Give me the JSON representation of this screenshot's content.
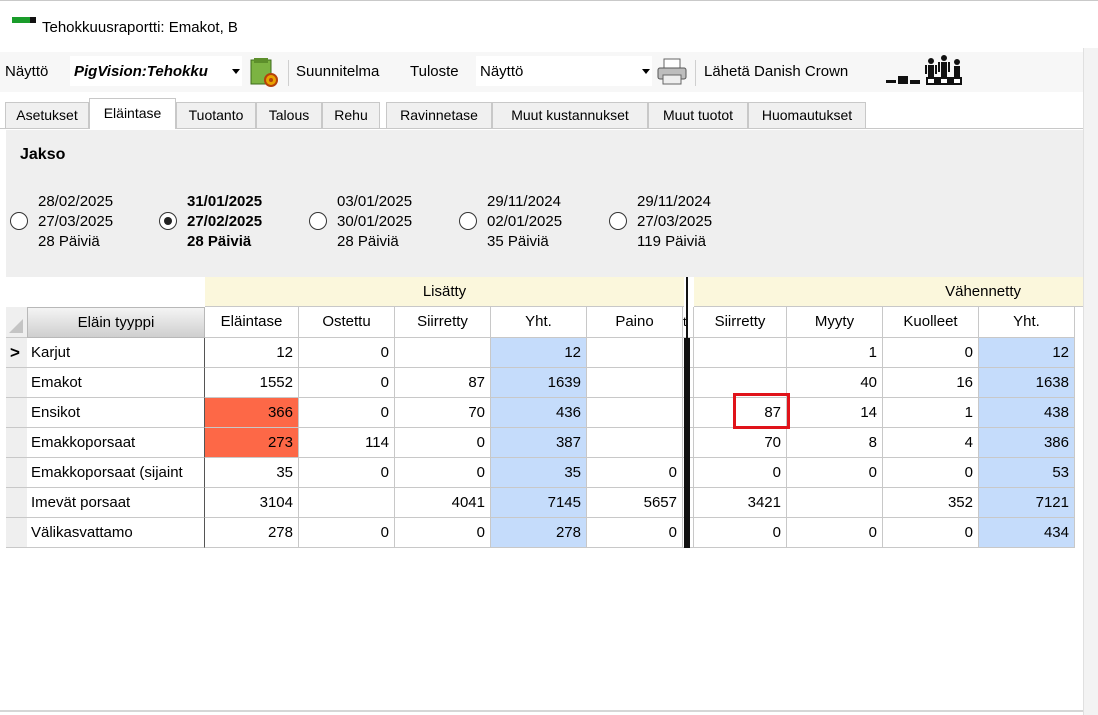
{
  "window": {
    "title": "Tehokkuusraportti: Emakot, B"
  },
  "toolbar": {
    "view_label": "Näyttö",
    "report_value": "PigVision:Tehokku",
    "plan_label": "Suunnitelma",
    "print_label": "Tuloste",
    "print_value": "Näyttö",
    "send_label": "Lähetä Danish Crown"
  },
  "tabs": [
    {
      "label": "Asetukset"
    },
    {
      "label": "Eläintase"
    },
    {
      "label": "Tuotanto"
    },
    {
      "label": "Talous"
    },
    {
      "label": "Rehu"
    },
    {
      "label": "Ravinnetase"
    },
    {
      "label": "Muut kustannukset"
    },
    {
      "label": "Muut tuotot"
    },
    {
      "label": "Huomautukset"
    }
  ],
  "period": {
    "heading": "Jakso",
    "options": [
      {
        "line1": "28/02/2025",
        "line2": "27/03/2025",
        "line3": "28 Päiviä",
        "selected": false
      },
      {
        "line1": "31/01/2025",
        "line2": "27/02/2025",
        "line3": "28 Päiviä",
        "selected": true
      },
      {
        "line1": "03/01/2025",
        "line2": "30/01/2025",
        "line3": "28 Päiviä",
        "selected": false
      },
      {
        "line1": "29/11/2024",
        "line2": "02/01/2025",
        "line3": "35 Päiviä",
        "selected": false
      },
      {
        "line1": "29/11/2024",
        "line2": "27/03/2025",
        "line3": "119 Päiviä",
        "selected": false
      }
    ]
  },
  "grid": {
    "group_added": "Lisätty",
    "group_reduced": "Vähennetty",
    "type_header": "Eläin tyyppi",
    "gap_header": "t",
    "columns": [
      "Eläintase",
      "Ostettu",
      "Siirretty",
      "Yht.",
      "Paino",
      "Siirretty",
      "Myyty",
      "Kuolleet",
      "Yht."
    ],
    "current_row_marker": ">",
    "rows": [
      {
        "name": "Karjut",
        "values": [
          "12",
          "0",
          "",
          "12",
          "",
          "",
          "1",
          "0",
          "12"
        ]
      },
      {
        "name": "Emakot",
        "values": [
          "1552",
          "0",
          "87",
          "1639",
          "",
          "",
          "40",
          "16",
          "1638"
        ]
      },
      {
        "name": "Ensikot",
        "values": [
          "366",
          "0",
          "70",
          "436",
          "",
          "87",
          "14",
          "1",
          "438"
        ]
      },
      {
        "name": "Emakkoporsaat",
        "values": [
          "273",
          "114",
          "0",
          "387",
          "",
          "70",
          "8",
          "4",
          "386"
        ]
      },
      {
        "name": "Emakkoporsaat (sijaint",
        "values": [
          "35",
          "0",
          "0",
          "35",
          "0",
          "0",
          "0",
          "0",
          "53"
        ]
      },
      {
        "name": "Imevät porsaat",
        "values": [
          "3104",
          "",
          "4041",
          "7145",
          "5657",
          "3421",
          "",
          "352",
          "7121"
        ]
      },
      {
        "name": "Välikasvattamo",
        "values": [
          "278",
          "0",
          "0",
          "278",
          "0",
          "0",
          "0",
          "0",
          "434"
        ]
      }
    ]
  },
  "colors": {
    "highlight": "#fd6847",
    "total_column": "#c5dcfb",
    "group_header": "#fbf7dc",
    "annotation_box": "#e0131a"
  }
}
